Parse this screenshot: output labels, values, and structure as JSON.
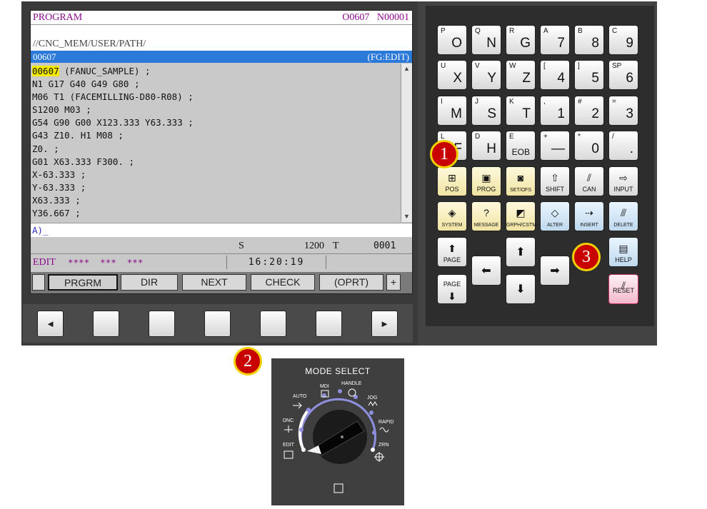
{
  "screen": {
    "header_left": "PROGRAM",
    "header_prog": "O0607",
    "header_seq": "N00001",
    "path": "//CNC_MEM/USER/PATH/",
    "selected_program": "00607",
    "edit_flag": "(FG:EDIT)",
    "code_first_hl": "00607",
    "code_first_rest": " (FANUC_SAMPLE) ;",
    "code_lines": [
      "N1 G17 G40 G49 G80 ;",
      "M06 T1 (FACEMILLING-D80-R08) ;",
      "S1200 M03 ;",
      "G54 G90 G00 X123.333 Y63.333 ;",
      "G43 Z10. H1 M08 ;",
      "Z0. ;",
      "G01 X63.333 F300. ;",
      "X-63.333 ;",
      "Y-63.333 ;",
      "X63.333 ;",
      "Y36.667 ;"
    ],
    "input_prompt": "A)_",
    "spindle_label": "S",
    "spindle_value": "1200",
    "tool_label": "T",
    "tool_value": "0001",
    "mode": "EDIT",
    "status_stars": "****  ***  ***",
    "clock": "16:20:19",
    "softkeys": [
      "PRGRM",
      "DIR",
      "NEXT",
      "CHECK",
      "(OPRT)"
    ],
    "softkey_more": "+"
  },
  "soft_buttons": {
    "left_arrow": "◄",
    "right_arrow": "►"
  },
  "keypad": {
    "keys": [
      {
        "sub": "P",
        "main": "O"
      },
      {
        "sub": "Q",
        "main": "N"
      },
      {
        "sub": "R",
        "main": "G"
      },
      {
        "sub": "A",
        "main": "7"
      },
      {
        "sub": "B",
        "main": "8"
      },
      {
        "sub": "C",
        "main": "9"
      },
      {
        "sub": "U",
        "main": "X"
      },
      {
        "sub": "V",
        "main": "Y"
      },
      {
        "sub": "W",
        "main": "Z"
      },
      {
        "sub": "[",
        "main": "4"
      },
      {
        "sub": "]",
        "main": "5"
      },
      {
        "sub": "SP",
        "main": "6"
      },
      {
        "sub": "I",
        "main": "M"
      },
      {
        "sub": "J",
        "main": "S"
      },
      {
        "sub": "K",
        "main": "T"
      },
      {
        "sub": ",",
        "main": "1"
      },
      {
        "sub": "#",
        "main": "2"
      },
      {
        "sub": "=",
        "main": "3"
      },
      {
        "sub": "L",
        "main": "F"
      },
      {
        "sub": "D",
        "main": "H"
      },
      {
        "sub": "E",
        "main": "EOB"
      },
      {
        "sub": "+",
        "main": "—"
      },
      {
        "sub": "*",
        "main": "0"
      },
      {
        "sub": "/",
        "main": "."
      }
    ],
    "fn_pos": "POS",
    "fn_prog": "PROG",
    "fn_offset": "SET",
    "fn_offset_sup": "OFS",
    "fn_shift": "SHIFT",
    "fn_can": "CAN",
    "fn_input": "INPUT",
    "fn_system": "SYSTEM",
    "fn_message": "MESSAGE",
    "fn_graph": "GRPH",
    "fn_graph_sup": "CSTM",
    "fn_alter": "ALTER",
    "fn_insert": "INSERT",
    "fn_delete": "DELETE",
    "page_up": "PAGE",
    "page_down": "PAGE",
    "help": "HELP",
    "reset": "RESET"
  },
  "callouts": [
    "1",
    "2",
    "3"
  ],
  "mode_select": {
    "title": "MODE SELECT",
    "labels": {
      "mdi": "MDI",
      "handle": "HANDLE",
      "auto": "AUTO",
      "jog": "JOG",
      "dnc": "DNC",
      "rapid": "RAPID",
      "edit": "EDIT",
      "zrn": "ZRN"
    }
  },
  "colors": {
    "header_text": "#8a0b8a",
    "selection_bar": "#2b79d9",
    "highlight": "#f3e900",
    "badge": "#c80000",
    "badge_ring": "#f0d000"
  }
}
